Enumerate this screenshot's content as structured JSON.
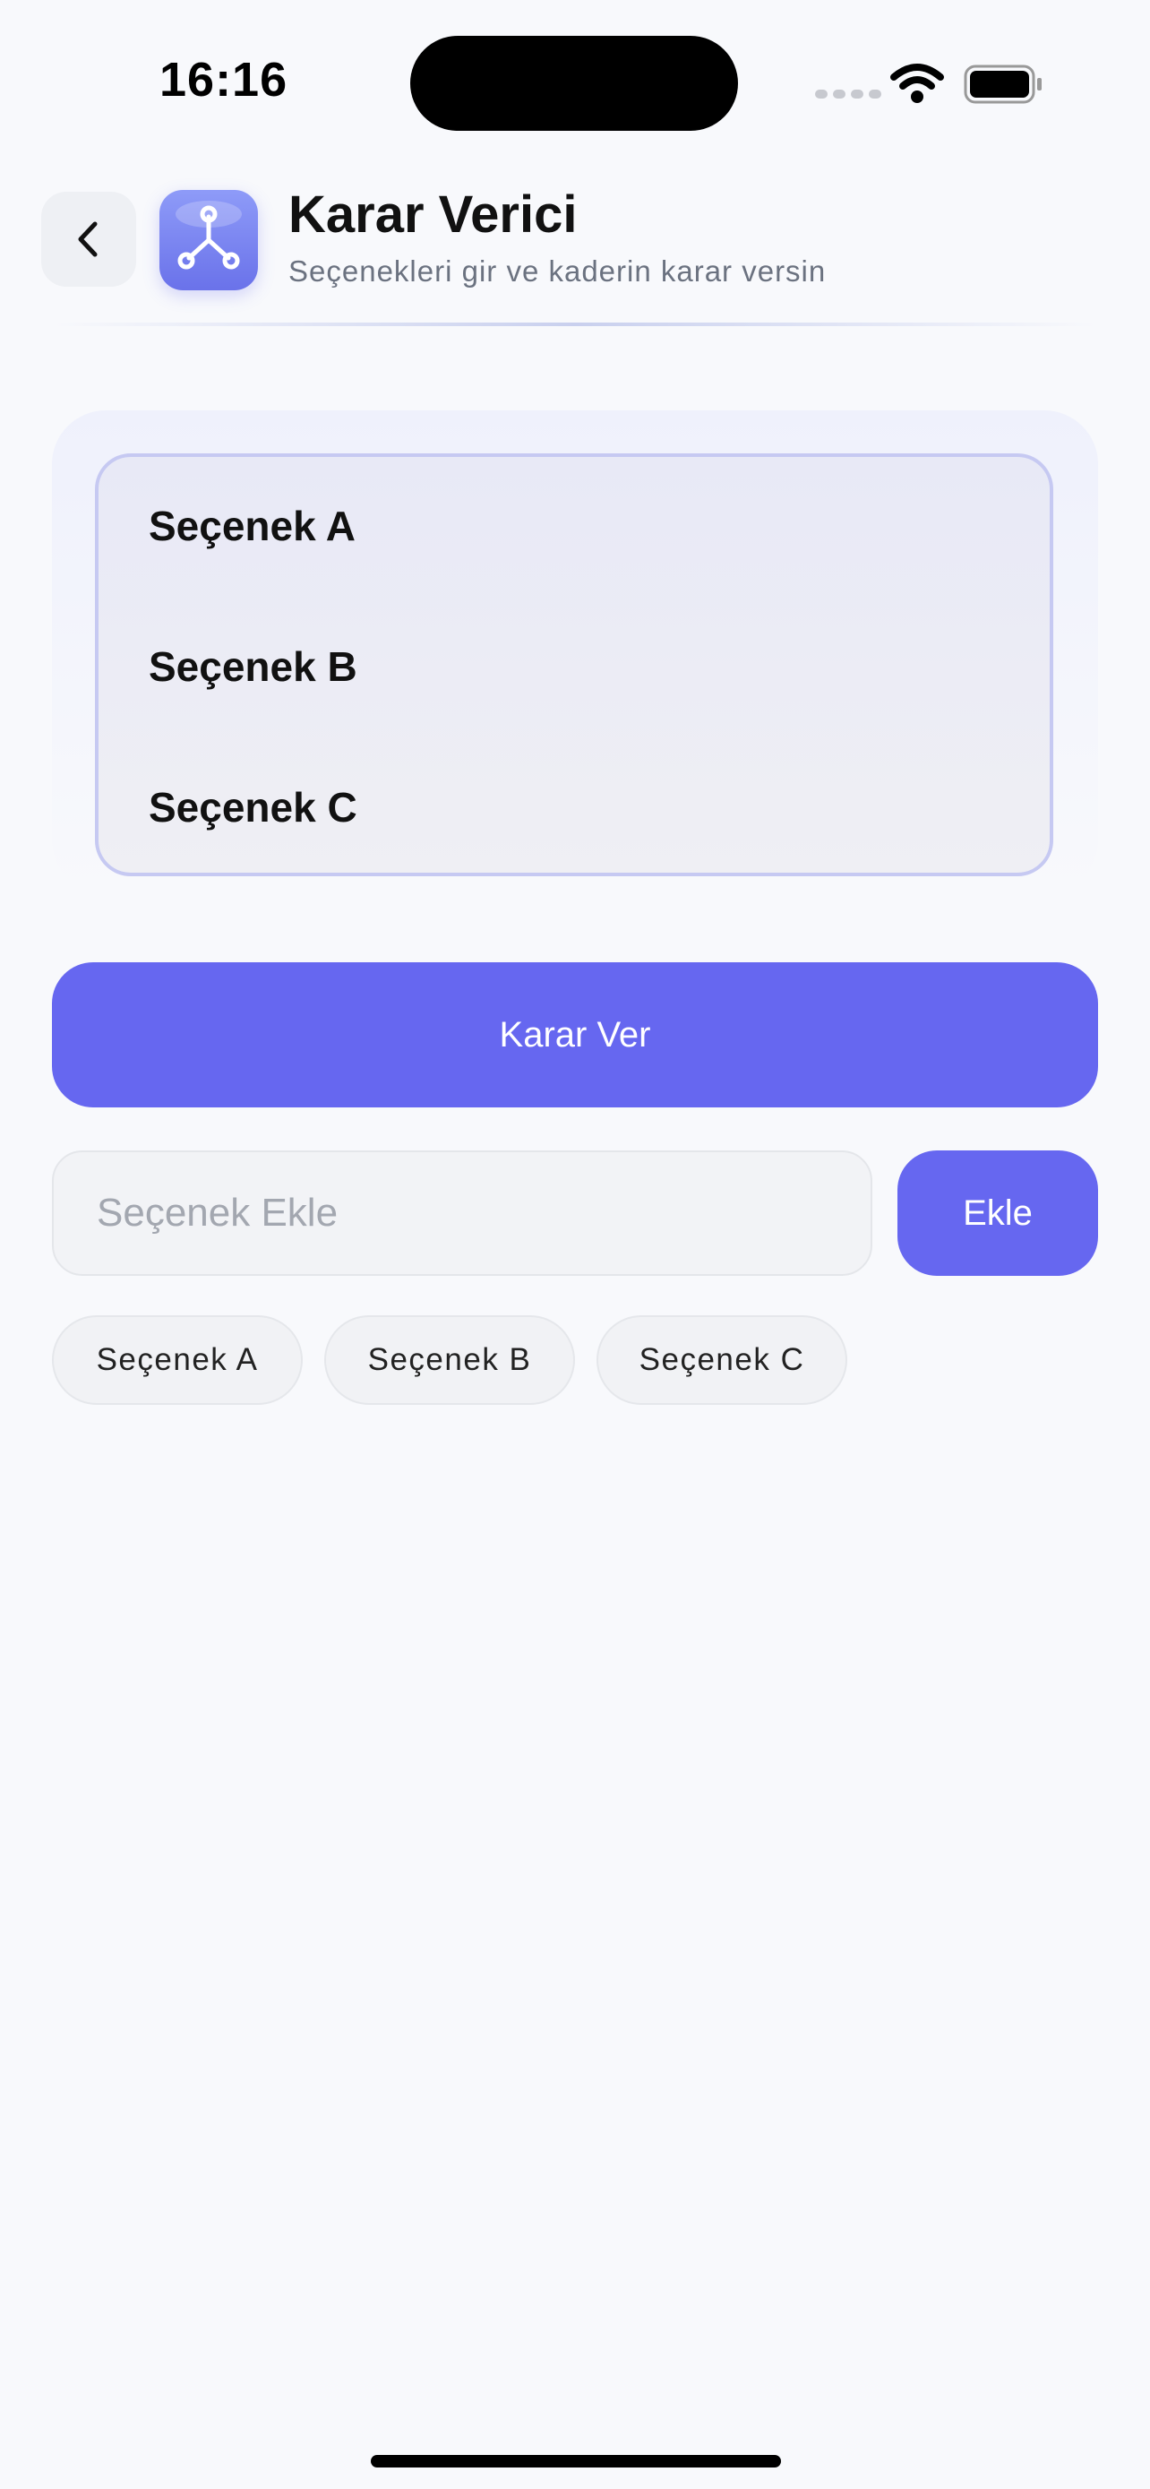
{
  "status_bar": {
    "time": "16:16"
  },
  "header": {
    "title": "Karar Verici",
    "subtitle": "Seçenekleri gir ve kaderin karar versin",
    "back_icon": "chevron-left-icon",
    "app_icon": "branch-icon"
  },
  "options_list": [
    "Seçenek A",
    "Seçenek B",
    "Seçenek C"
  ],
  "decide_button": {
    "label": "Karar Ver"
  },
  "add_option": {
    "value": "",
    "placeholder": "Seçenek Ekle",
    "button_label": "Ekle"
  },
  "chips": [
    "Seçenek A",
    "Seçenek B",
    "Seçenek C"
  ],
  "colors": {
    "accent": "#6667f0",
    "background": "#f8f9fc"
  }
}
